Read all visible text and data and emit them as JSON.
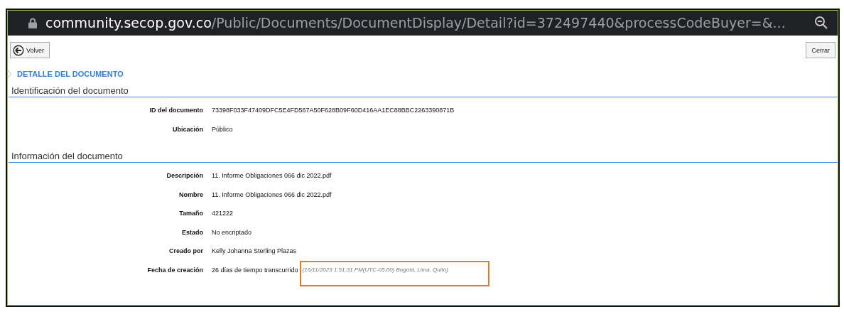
{
  "address_bar": {
    "host": "community.secop.gov.co",
    "path": "/Public/Documents/DocumentDisplay/Detail?id=372497440&processCodeBuyer=&..."
  },
  "toolbar": {
    "back_button": "Volver",
    "close_button": "Cerrar"
  },
  "heading": "DETALLE DEL DOCUMENTO",
  "sections": [
    {
      "title": "Identificación del documento",
      "fields": [
        {
          "label": "ID del documento",
          "value": "73398F033F47409DFC5E4FD567A50F628B09F60D416AA1EC88BBC2263390871B"
        },
        {
          "label": "Ubicación",
          "value": "Público"
        }
      ]
    },
    {
      "title": "Información del documento",
      "fields": [
        {
          "label": "Descripción",
          "value": "11. Informe Obligaciones 066 dic 2022.pdf"
        },
        {
          "label": "Nombre",
          "value": "11. Informe Obligaciones 066 dic 2022.pdf"
        },
        {
          "label": "Tamaño",
          "value": "421222"
        },
        {
          "label": "Estado",
          "value": "No encriptado"
        },
        {
          "label": "Creado por",
          "value": "Kelly Johanna Sterling Plazas"
        },
        {
          "label": "Fecha de creación",
          "value": "26 días de tiempo transcurrido",
          "timestamp": "(16/11/2023 1:51:31 PM(UTC-05:00) Bogotá, Lima, Quito)",
          "highlighted": true
        }
      ]
    }
  ]
}
